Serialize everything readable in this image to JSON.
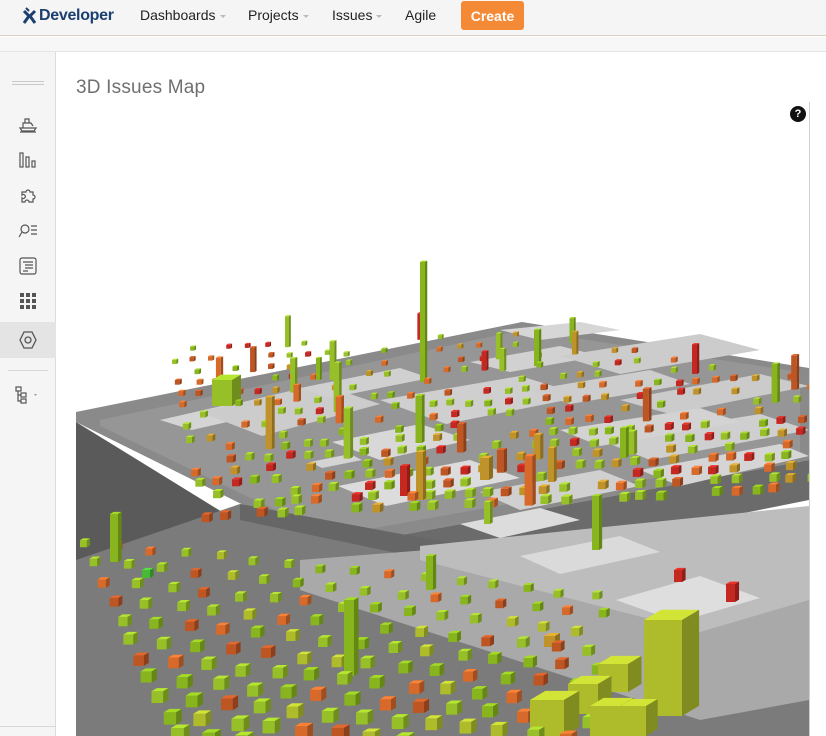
{
  "header": {
    "logo_text": "Developer",
    "nav": [
      {
        "label": "Dashboards",
        "has_caret": true
      },
      {
        "label": "Projects",
        "has_caret": true
      },
      {
        "label": "Issues",
        "has_caret": true
      },
      {
        "label": "Agile",
        "has_caret": false
      }
    ],
    "create_label": "Create",
    "accent_color": "#f58a36",
    "brand_color": "#1b3f6e"
  },
  "sidebar": {
    "items": [
      {
        "icon": "ship-icon"
      },
      {
        "icon": "bar-chart-icon"
      },
      {
        "icon": "puzzle-icon"
      },
      {
        "icon": "search-list-icon"
      },
      {
        "icon": "document-list-icon"
      },
      {
        "icon": "grid-icon"
      },
      {
        "icon": "hexagon-icon",
        "active": true
      },
      {
        "icon": "hierarchy-icon",
        "has_caret": true
      }
    ]
  },
  "main": {
    "title": "3D Issues Map",
    "help_label": "?"
  },
  "map": {
    "colors": {
      "green": "#9ec92a",
      "lime": "#8fbf1e",
      "yellow_green": "#b7c62e",
      "orange": "#e2702c",
      "dark_orange": "#c85a25",
      "red": "#cf2a22",
      "amber": "#c99b2c",
      "bright_green": "#4cc23a"
    }
  }
}
